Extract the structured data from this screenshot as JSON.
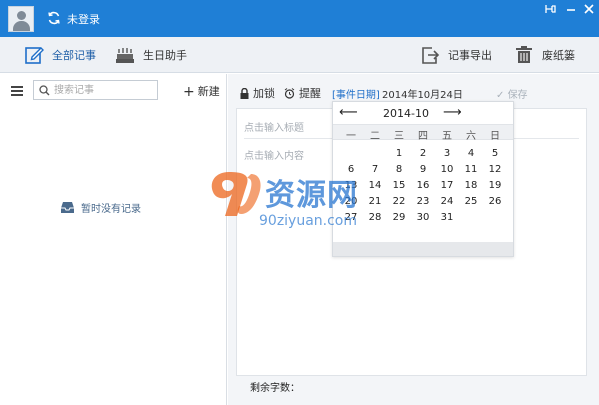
{
  "titlebar": {
    "login_status": "未登录"
  },
  "toolbar": {
    "all_notes": "全部记事",
    "birthday": "生日助手",
    "export": "记事导出",
    "trash": "废纸篓"
  },
  "left": {
    "search_placeholder": "搜索记事",
    "new_label": "新建",
    "empty_label": "暂时没有记录"
  },
  "editor": {
    "lock_label": "加锁",
    "remind_label": "提醒",
    "event_tag": "[事件日期]",
    "event_date": "2014年10月24日",
    "save_label": "保存",
    "title_placeholder": "点击输入标题",
    "content_placeholder": "点击输入内容",
    "wordcount_label": "剩余字数："
  },
  "calendar": {
    "prev": "⟵",
    "next": "⟶",
    "month": "2014-10",
    "weekdays": [
      "一",
      "二",
      "三",
      "四",
      "五",
      "六",
      "日"
    ],
    "rows": [
      [
        "",
        "",
        "1",
        "2",
        "3",
        "4",
        "5"
      ],
      [
        "6",
        "7",
        "8",
        "9",
        "10",
        "11",
        "12"
      ],
      [
        "13",
        "14",
        "15",
        "16",
        "17",
        "18",
        "19"
      ],
      [
        "20",
        "21",
        "22",
        "23",
        "24",
        "25",
        "26"
      ],
      [
        "27",
        "28",
        "29",
        "30",
        "31",
        "",
        ""
      ]
    ]
  },
  "watermark": {
    "brand": "资源网",
    "url": "90ziyuan.com"
  },
  "colors": {
    "titlebar": "#1f7fd6",
    "accent": "#1f6fc9"
  }
}
